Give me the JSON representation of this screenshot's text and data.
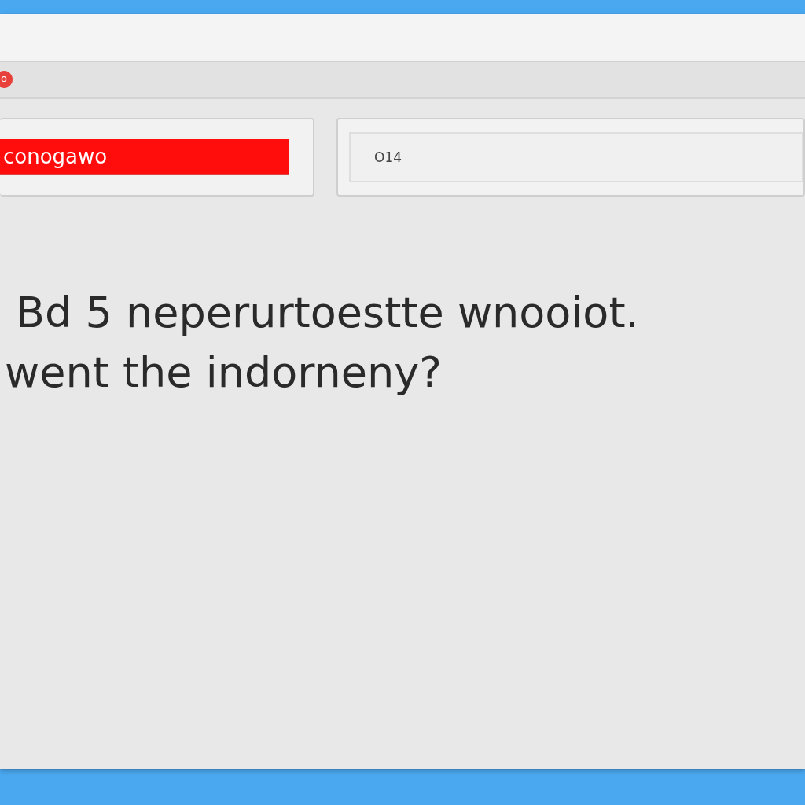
{
  "toolbar": {
    "badge": "o"
  },
  "fields": [
    {
      "value": "conogawo",
      "kind": "alert"
    },
    {
      "value": "O14",
      "kind": "plain"
    }
  ],
  "question": {
    "lines": [
      "Bd 5 neperurtoestte wnooiot.",
      "went the indorneny?"
    ]
  }
}
